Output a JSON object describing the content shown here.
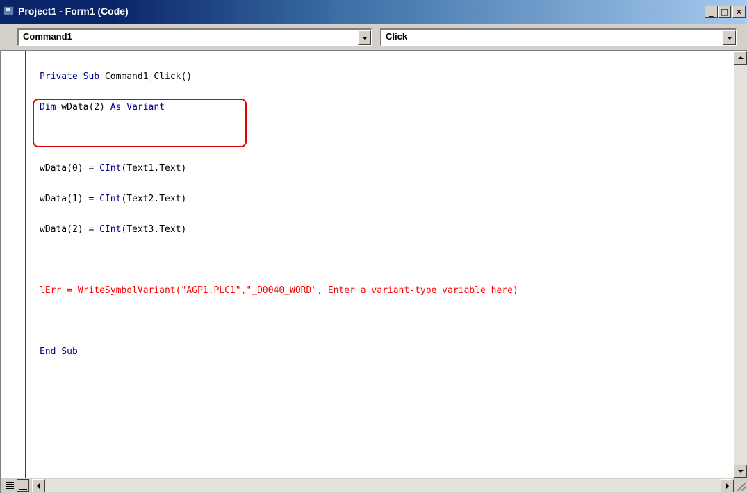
{
  "window": {
    "title": "Project1 - Form1 (Code)",
    "controls": {
      "minimize": "_",
      "maximize": "□",
      "close": "×"
    }
  },
  "combos": {
    "object": {
      "value": "Command1"
    },
    "procedure": {
      "value": "Click"
    }
  },
  "code": {
    "line1_kw": "Private Sub",
    "line1_tx": " Command1_Click()",
    "line2_kw1": "Dim",
    "line2_tx": " wData(2) ",
    "line2_kw2": "As Variant",
    "line3_a": "wData(0) = ",
    "line3_kw": "CInt",
    "line3_b": "(Text1.Text)",
    "line4_a": "wData(1) = ",
    "line4_kw": "CInt",
    "line4_b": "(Text2.Text)",
    "line5_a": "wData(2) = ",
    "line5_kw": "CInt",
    "line5_b": "(Text3.Text)",
    "line6": "lErr = WriteSymbolVariant(\"AGP1.PLC1\",\"_D0040_WORD\", Enter a variant-type variable here)",
    "line7_kw": "End Sub"
  },
  "colors": {
    "keyword": "#00008b",
    "error": "#ff0000",
    "highlight": "#e00000"
  },
  "icons": [
    "app-icon",
    "minimize-icon",
    "maximize-icon",
    "close-icon",
    "chevron-down-icon",
    "scroll-up-icon",
    "scroll-down-icon",
    "scroll-left-icon",
    "scroll-right-icon",
    "procedure-view-icon",
    "full-module-view-icon",
    "resize-grip-icon"
  ]
}
